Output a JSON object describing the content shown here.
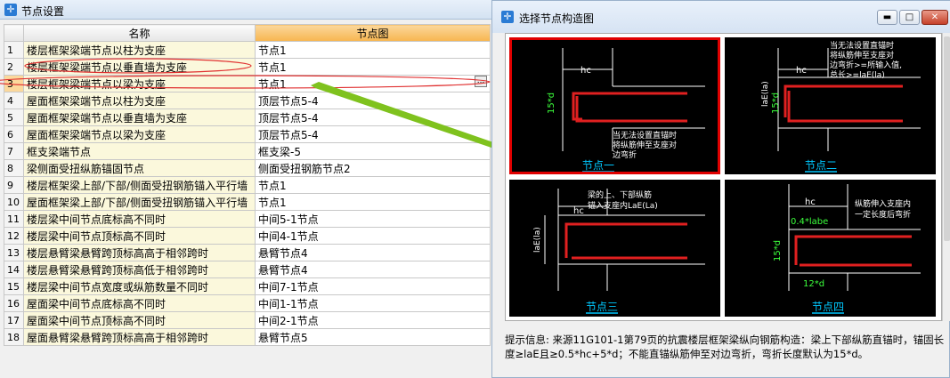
{
  "win1": {
    "title": "节点设置",
    "columns": [
      "名称",
      "节点图"
    ],
    "rows": [
      {
        "n": "1",
        "name": "楼层框架梁端节点以柱为支座",
        "node": "节点1"
      },
      {
        "n": "2",
        "name": "楼层框架梁端节点以垂直墙为支座",
        "node": "节点1"
      },
      {
        "n": "3",
        "name": "楼层框架梁端节点以梁为支座",
        "node": "节点1"
      },
      {
        "n": "4",
        "name": "屋面框架梁端节点以柱为支座",
        "node": "顶层节点5-4"
      },
      {
        "n": "5",
        "name": "屋面框架梁端节点以垂直墙为支座",
        "node": "顶层节点5-4"
      },
      {
        "n": "6",
        "name": "屋面框架梁端节点以梁为支座",
        "node": "顶层节点5-4"
      },
      {
        "n": "7",
        "name": "框支梁端节点",
        "node": "框支梁-5"
      },
      {
        "n": "8",
        "name": "梁侧面受扭纵筋锚固节点",
        "node": "侧面受扭钢筋节点2"
      },
      {
        "n": "9",
        "name": "楼层框架梁上部/下部/侧面受扭钢筋锚入平行墙",
        "node": "节点1"
      },
      {
        "n": "10",
        "name": "屋面框架梁上部/下部/侧面受扭钢筋锚入平行墙",
        "node": "节点1"
      },
      {
        "n": "11",
        "name": "楼层梁中间节点底标高不同时",
        "node": "中间5-1节点"
      },
      {
        "n": "12",
        "name": "楼层梁中间节点顶标高不同时",
        "node": "中间4-1节点"
      },
      {
        "n": "13",
        "name": "楼层悬臂梁悬臂跨顶标高高于相邻跨时",
        "node": "悬臂节点4"
      },
      {
        "n": "14",
        "name": "楼层悬臂梁悬臂跨顶标高低于相邻跨时",
        "node": "悬臂节点4"
      },
      {
        "n": "15",
        "name": "楼层梁中间节点宽度或纵筋数量不同时",
        "node": "中间7-1节点"
      },
      {
        "n": "16",
        "name": "屋面梁中间节点底标高不同时",
        "node": "中间1-1节点"
      },
      {
        "n": "17",
        "name": "屋面梁中间节点顶标高不同时",
        "node": "中间2-1节点"
      },
      {
        "n": "18",
        "name": "屋面悬臂梁悬臂跨顶标高高于相邻跨时",
        "node": "悬臂节点5"
      }
    ],
    "ellipsis": "..."
  },
  "win2": {
    "title": "选择节点构造图",
    "buttons": {
      "min": "▬",
      "max": "□",
      "close": "✕"
    },
    "panels": [
      {
        "label": "节点一",
        "note": [
          "当无法设置直锚时",
          "将纵筋伸至支座对",
          "边弯折"
        ],
        "hc": "hc",
        "dim": "15*d"
      },
      {
        "label": "节点二",
        "note": [
          "当无法设置直锚时",
          "将纵筋伸至支座对",
          "边弯折>=所输入值,",
          "总长>=laE(la)"
        ],
        "hc": "hc",
        "dim": "15*d",
        "dim2": "laE(la)"
      },
      {
        "label": "节点三",
        "note": [
          "梁的上、下部纵筋",
          "锚入支座内LaE(La)"
        ],
        "hc": "hc",
        "dim": "laE(la)"
      },
      {
        "label": "节点四",
        "note": [
          "纵筋伸入支座内",
          "一定长度后弯折"
        ],
        "hc": "hc",
        "dim": "15*d",
        "dim2": "0.4*labe",
        "dim3": "12*d"
      }
    ],
    "hint": "提示信息: 来源11G101-1第79页的抗震楼层框架梁纵向钢筋构造：梁上下部纵筋直锚时，锚固长度≥laE且≥0.5*hc+5*d；不能直锚纵筋伸至对边弯折，弯折长度默认为15*d。"
  },
  "colors": {
    "accent": "#f7b54f",
    "selected_border": "#e00000",
    "rebar": "#e02020",
    "label": "#00c8ff",
    "arrow": "#7fc21e"
  }
}
